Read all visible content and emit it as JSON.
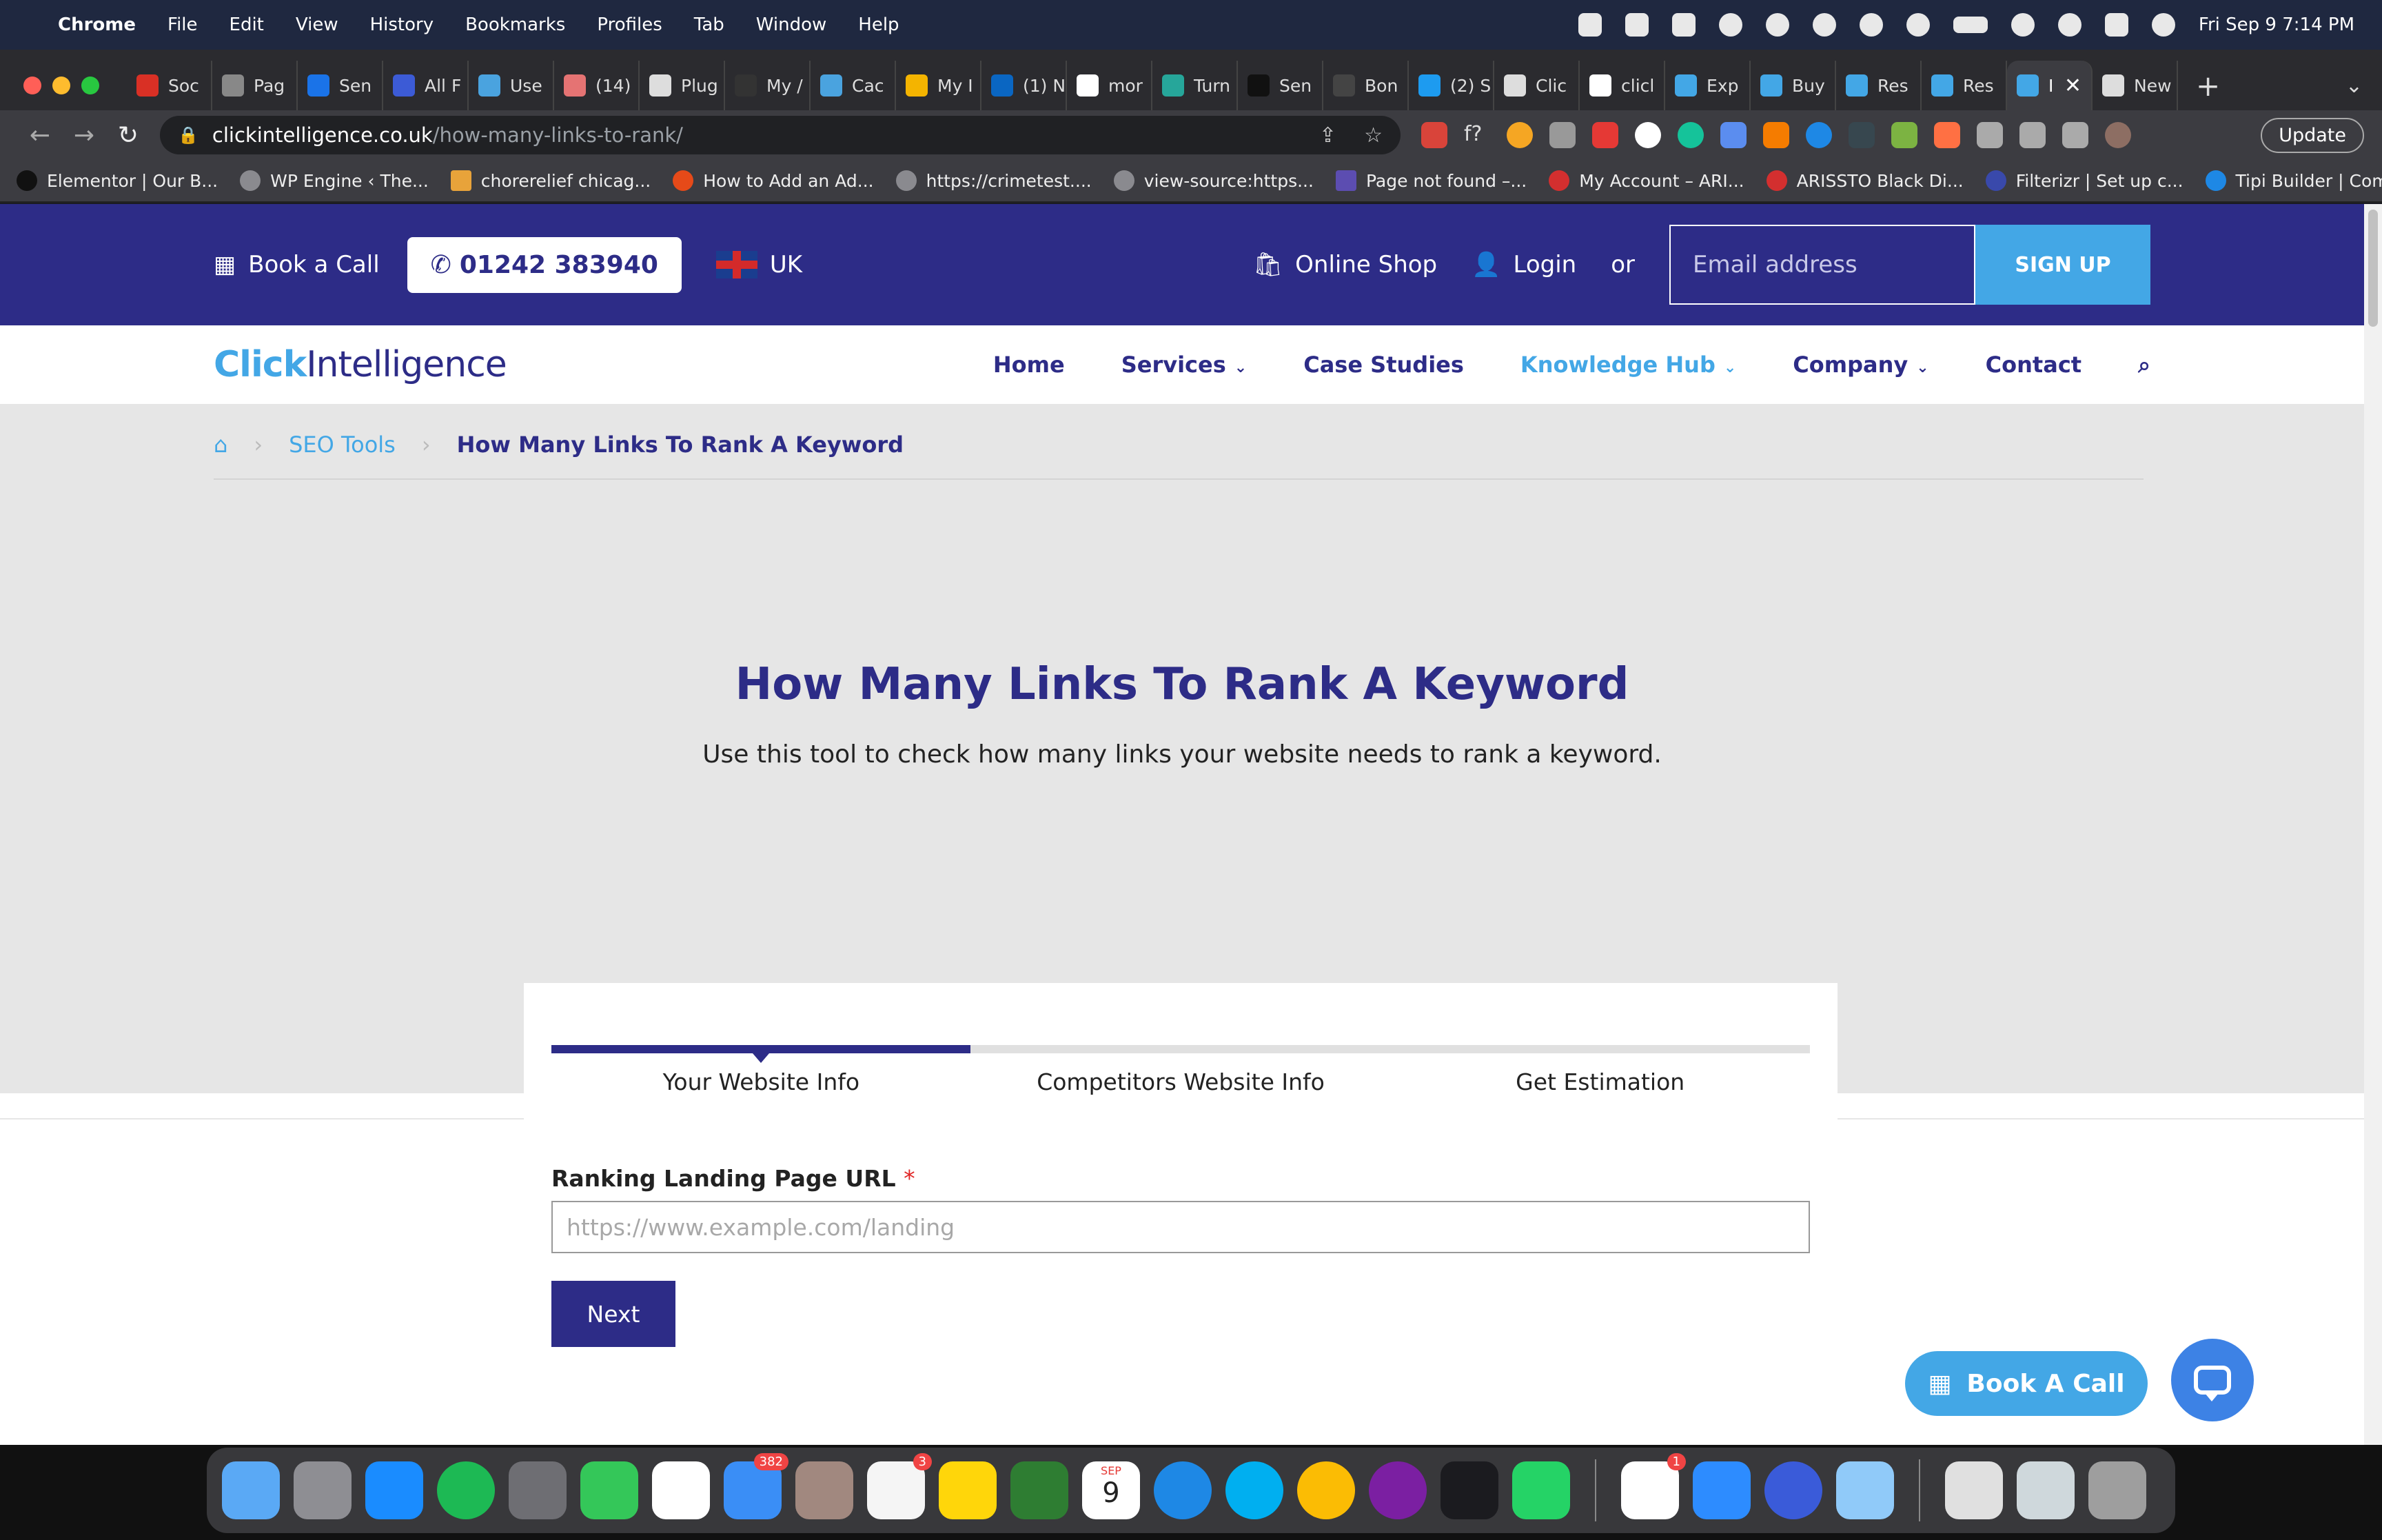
{
  "menubar": {
    "app": "Chrome",
    "items": [
      "File",
      "Edit",
      "View",
      "History",
      "Bookmarks",
      "Profiles",
      "Tab",
      "Window",
      "Help"
    ],
    "datetime": "Fri Sep 9  7:14 PM"
  },
  "tabs": [
    "Soc",
    "Pag",
    "Sen",
    "All F",
    "Use",
    "(14)",
    "Plug",
    "My /",
    "Cac",
    "My I",
    "(1) N",
    "mor",
    "Turn",
    "Sen",
    "Bon",
    "(2) S",
    "Clic",
    "clicl",
    "Exp",
    "Buy",
    "Res",
    "Res",
    "I",
    "New"
  ],
  "address": {
    "domain": "clickintelligence.co.uk",
    "path": "/how-many-links-to-rank/",
    "update_label": "Update"
  },
  "bookmarks": [
    "Elementor | Our B...",
    "WP Engine ‹ The...",
    "chorerelief chicag...",
    "How to Add an Ad...",
    "https://crimetest....",
    "view-source:https...",
    "Page not found –...",
    "My Account – ARI...",
    "ARISSTO Black Di...",
    "Filterizr | Set up c...",
    "Tipi Builder | Com..."
  ],
  "topbar": {
    "book_call": "Book a Call",
    "phone": "01242 383940",
    "region": "UK",
    "online_shop": "Online Shop",
    "login": "Login",
    "or": "or",
    "email_placeholder": "Email address",
    "signup": "SIGN UP"
  },
  "logo": {
    "prefix": "Click",
    "suffix": "Intelligence"
  },
  "nav": [
    "Home",
    "Services",
    "Case Studies",
    "Knowledge Hub",
    "Company",
    "Contact"
  ],
  "breadcrumb": {
    "parent": "SEO Tools",
    "current": "How Many Links To Rank A Keyword"
  },
  "hero": {
    "title": "How Many Links To Rank A Keyword",
    "subtitle": "Use this tool to check how many links your website needs to rank a keyword."
  },
  "wizard": {
    "progress_fraction": 0.333,
    "steps": [
      "Your Website Info",
      "Competitors Website Info",
      "Get Estimation"
    ],
    "field_label": "Ranking Landing Page URL",
    "required_mark": "*",
    "placeholder": "https://www.example.com/landing",
    "next": "Next"
  },
  "floating": {
    "book_call": "Book A Call"
  },
  "dock": {
    "badges": {
      "mail": "382",
      "reminders": "3",
      "slack": "1"
    },
    "calendar_month": "SEP",
    "calendar_day": "9"
  },
  "colors": {
    "brand_navy": "#2d2c87",
    "brand_blue": "#43a7e6"
  }
}
